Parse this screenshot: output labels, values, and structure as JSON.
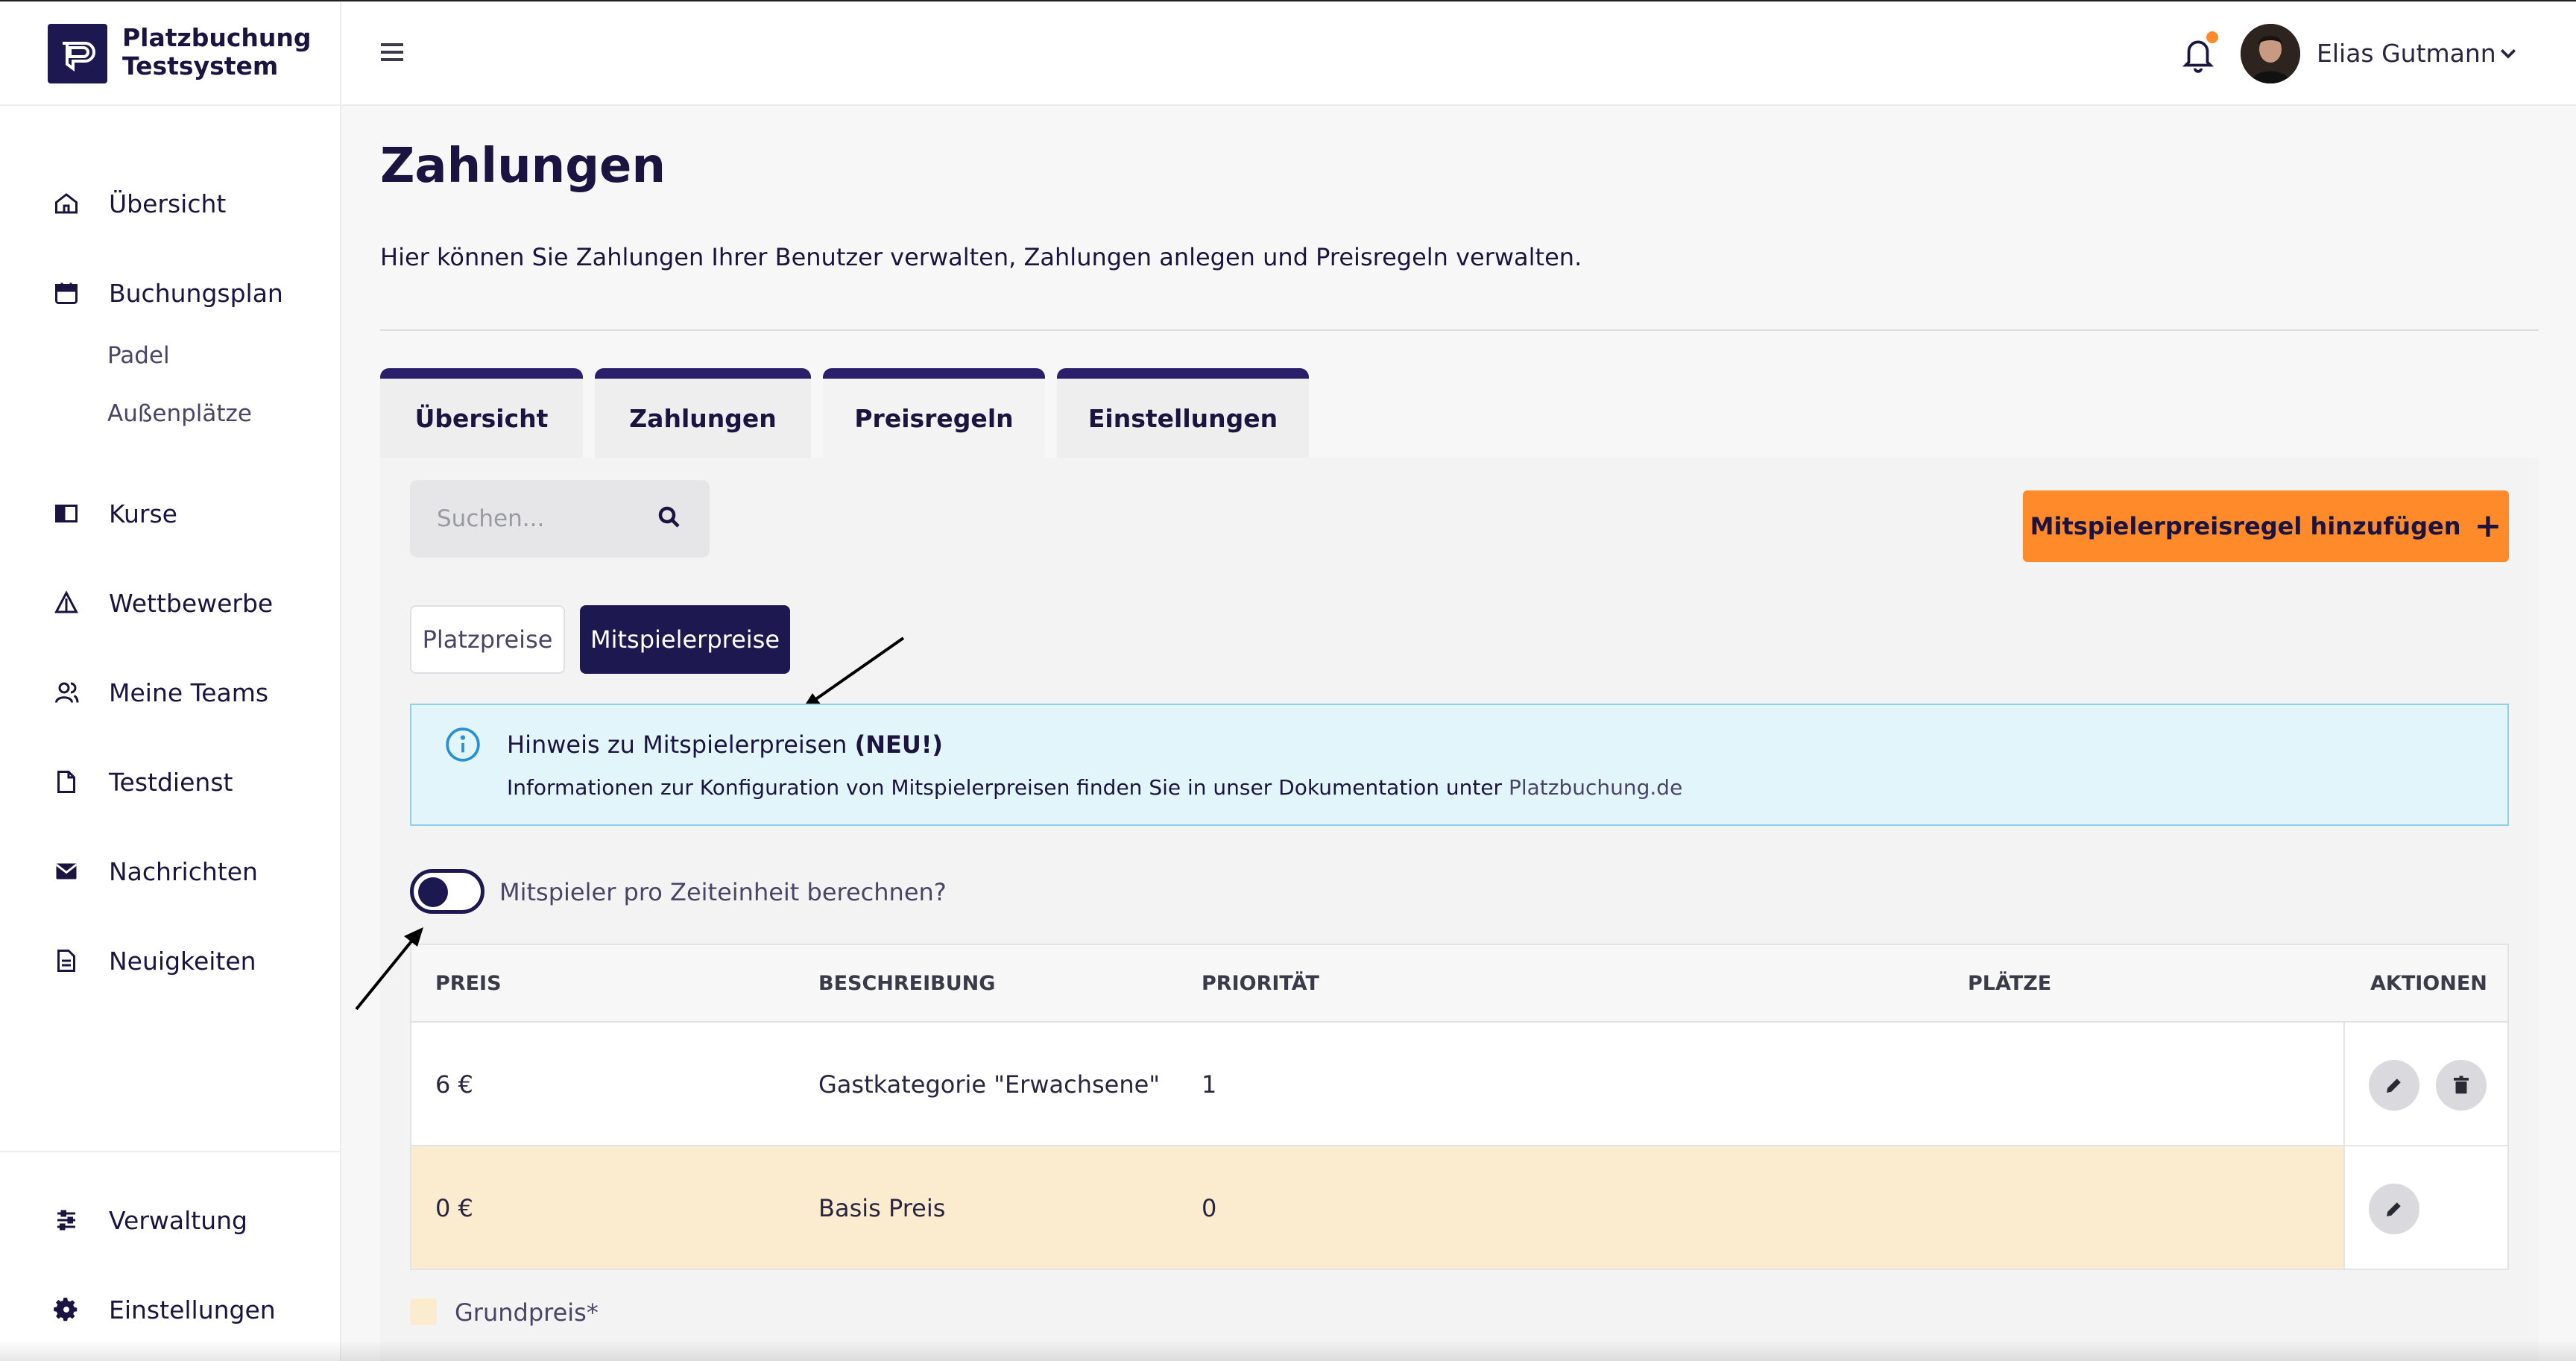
{
  "brand": {
    "line1": "Platzbuchung",
    "line2": "Testsystem"
  },
  "sidebar": {
    "items": [
      {
        "label": "Übersicht",
        "icon": "home-icon"
      },
      {
        "label": "Buchungsplan",
        "icon": "calendar-icon"
      },
      {
        "label": "Kurse",
        "icon": "book-icon"
      },
      {
        "label": "Wettbewerbe",
        "icon": "trophy-icon"
      },
      {
        "label": "Meine Teams",
        "icon": "users-icon"
      },
      {
        "label": "Testdienst",
        "icon": "file-icon"
      },
      {
        "label": "Nachrichten",
        "icon": "mail-icon"
      },
      {
        "label": "Neuigkeiten",
        "icon": "news-icon"
      }
    ],
    "sub_items": [
      "Padel",
      "Außenplätze"
    ],
    "bottom_items": [
      {
        "label": "Verwaltung",
        "icon": "sliders-icon"
      },
      {
        "label": "Einstellungen",
        "icon": "gear-icon"
      }
    ]
  },
  "topbar": {
    "user_name": "Elias Gutmann",
    "notification_dot_color": "#ff8a2a"
  },
  "page": {
    "title": "Zahlungen",
    "description": "Hier können Sie Zahlungen Ihrer Benutzer verwalten, Zahlungen anlegen und Preisregeln verwalten."
  },
  "tabs": [
    {
      "label": "Übersicht"
    },
    {
      "label": "Zahlungen"
    },
    {
      "label": "Preisregeln",
      "active": true
    },
    {
      "label": "Einstellungen"
    }
  ],
  "search": {
    "placeholder": "Suchen..."
  },
  "add_button": {
    "label": "Mitspielerpreisregel hinzufügen",
    "plus": "+"
  },
  "price_toggle": {
    "option1": "Platzpreise",
    "option2": "Mitspielerpreise",
    "selected": "Mitspielerpreise"
  },
  "info": {
    "title": "Hinweis zu Mitspielerpreisen",
    "title_bold": "(NEU!)",
    "text": "Informationen zur Konfiguration von Mitspielerpreisen finden Sie in unser Dokumentation unter",
    "link": "Platzbuchung.de"
  },
  "switch": {
    "label": "Mitspieler pro Zeiteinheit berechnen?",
    "on": false
  },
  "table": {
    "headers": [
      "PREIS",
      "BESCHREIBUNG",
      "PRIORITÄT",
      "PLÄTZE",
      "AKTIONEN"
    ],
    "rows": [
      {
        "preis": "6 €",
        "beschreibung": "Gastkategorie \"Erwachsene\"",
        "prioritaet": "1",
        "plaetze": ""
      },
      {
        "preis": "0 €",
        "beschreibung": "Basis Preis",
        "prioritaet": "0",
        "plaetze": ""
      }
    ]
  },
  "legend": {
    "label": "Grundpreis*",
    "color": "#fbeccf"
  },
  "colors": {
    "primary": "#1d1850",
    "accent": "#ff8a2a",
    "info_bg": "#e1f5fb"
  }
}
